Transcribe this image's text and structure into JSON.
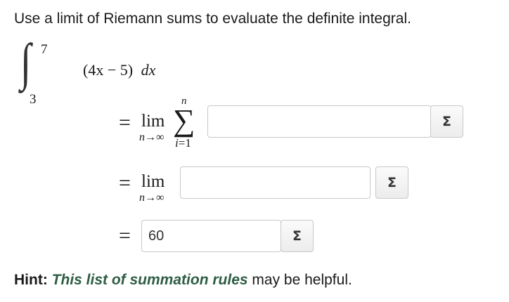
{
  "instruction": "Use a limit of Riemann sums to evaluate the definite integral.",
  "integral": {
    "upper_limit": "7",
    "lower_limit": "3",
    "integrand": "(4x − 5)",
    "differential": "dx"
  },
  "step1": {
    "equals": "=",
    "lim_word": "lim",
    "lim_sub_var": "n",
    "lim_sub_arrow": "→",
    "lim_sub_inf": "∞",
    "sum_upper": "n",
    "sum_symbol": "∑",
    "sum_lower_var": "i",
    "sum_lower_rest": "=1",
    "answer_value": "",
    "sigma_button_label": "Σ"
  },
  "step2": {
    "equals": "=",
    "lim_word": "lim",
    "lim_sub_var": "n",
    "lim_sub_arrow": "→",
    "lim_sub_inf": "∞",
    "answer_value": "",
    "sigma_button_label": "Σ"
  },
  "step3": {
    "equals": "=",
    "answer_value": "60",
    "sigma_button_label": "Σ"
  },
  "hint": {
    "label": "Hint:",
    "link_text": "This list of summation rules",
    "rest": " may be helpful."
  }
}
